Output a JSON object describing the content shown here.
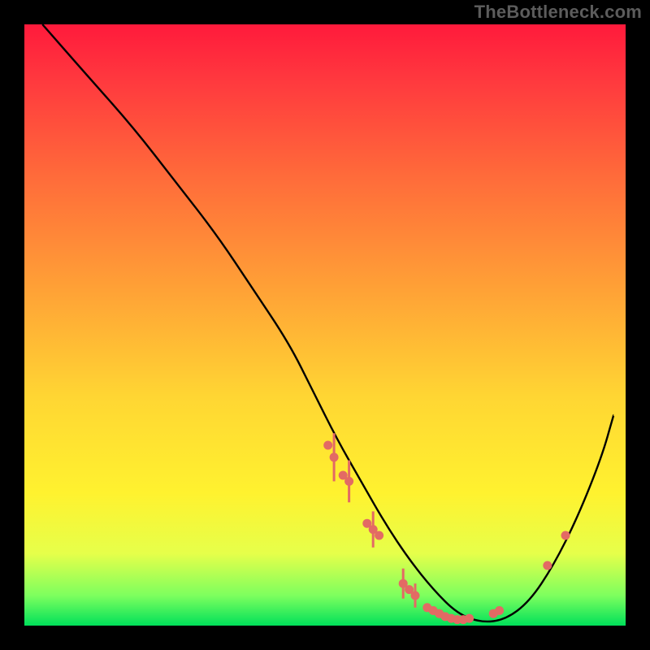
{
  "watermark": "TheBottleneck.com",
  "colors": {
    "background": "#000000",
    "gradient_top": "#ff1a3c",
    "gradient_mid": "#fff22f",
    "gradient_bottom": "#00e05a",
    "curve": "#000000",
    "marker": "#e36a64"
  },
  "chart_data": {
    "type": "line",
    "title": "",
    "xlabel": "",
    "ylabel": "",
    "xlim": [
      0,
      100
    ],
    "ylim": [
      0,
      100
    ],
    "grid": false,
    "curve": {
      "description": "Bottleneck curve: high on left, drops to near zero around x≈70, rises again toward right",
      "x": [
        3,
        10,
        18,
        25,
        32,
        38,
        44,
        48,
        52,
        56,
        60,
        64,
        68,
        72,
        76,
        80,
        84,
        88,
        92,
        96,
        98
      ],
      "y": [
        100,
        92,
        83,
        74,
        65,
        56,
        47,
        39,
        31,
        24,
        17,
        11,
        6,
        2,
        0.5,
        1,
        4,
        10,
        18,
        28,
        35
      ]
    },
    "markers": {
      "x": [
        50.5,
        51.5,
        53,
        54,
        57,
        58,
        59,
        63,
        64,
        65,
        67,
        68,
        69,
        70,
        71,
        72,
        73,
        74,
        78,
        79,
        87,
        90
      ],
      "y": [
        30,
        28,
        25,
        24,
        17,
        16,
        15,
        7,
        6,
        5,
        3,
        2.5,
        2,
        1.5,
        1.2,
        1,
        1,
        1.2,
        2,
        2.5,
        10,
        15
      ],
      "err": [
        0,
        4,
        0,
        3.5,
        0,
        3,
        0,
        2.5,
        0,
        2,
        0,
        0,
        0,
        0,
        0,
        0,
        0,
        0,
        0,
        0,
        0,
        0
      ]
    }
  }
}
